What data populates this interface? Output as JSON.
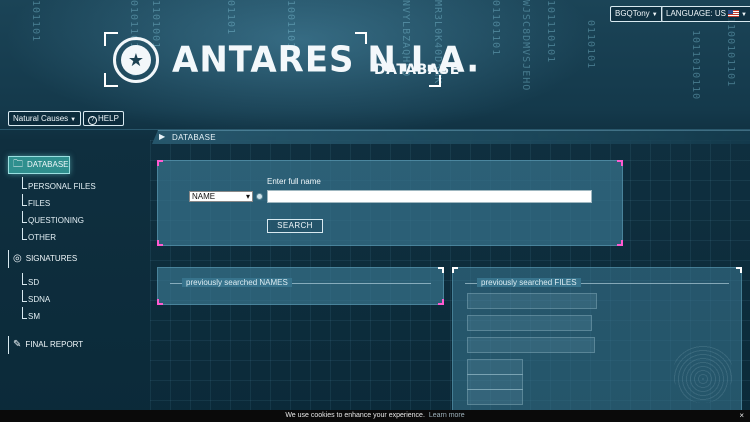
{
  "header": {
    "title": "ANTARES N.I.A.",
    "subtitle": "DATABASE",
    "user_label": "BGQTony",
    "language_label": "LANGUAGE: US"
  },
  "toolbar": {
    "case_select": "Natural Causes",
    "help_label": "HELP"
  },
  "breadcrumb": {
    "current": "DATABASE"
  },
  "sidebar": {
    "database": {
      "label": "DATABASE",
      "items": [
        {
          "label": "PERSONAL FILES"
        },
        {
          "label": "FILES"
        },
        {
          "label": "QUESTIONING"
        },
        {
          "label": "OTHER"
        }
      ]
    },
    "signatures": {
      "label": "SIGNATURES",
      "items": [
        {
          "label": "SD"
        },
        {
          "label": "SDNA"
        },
        {
          "label": "SM"
        }
      ]
    },
    "final_report": {
      "label": "FINAL REPORT"
    }
  },
  "search": {
    "field_label": "Enter full name",
    "type_selected": "NAME",
    "input_value": "",
    "button_label": "SEARCH"
  },
  "previous": {
    "names_legend": "previously searched NAMES",
    "files_legend": "previously searched FILES"
  },
  "cookie": {
    "text": "We use cookies to enhance your experience.",
    "link": "Learn more",
    "close": "×"
  },
  "colors": {
    "accent_pink": "#ff5ad1",
    "active_teal": "#2f8f8e",
    "panel_blue": "#37738c"
  },
  "icons": {
    "logo": "antares-star-emblem",
    "help": "question-circle-icon",
    "database": "folder-icon",
    "signatures": "fingerprint-icon",
    "final_report": "document-edit-icon"
  }
}
